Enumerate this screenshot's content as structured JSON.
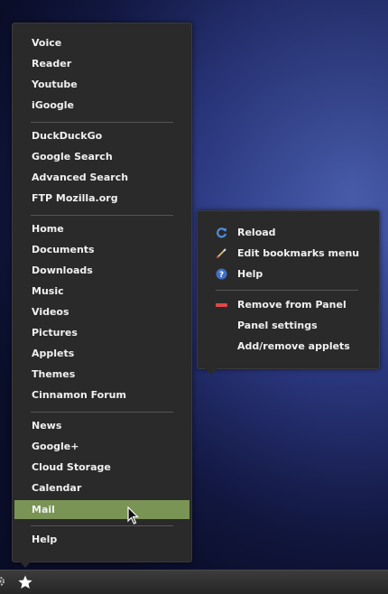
{
  "bookmarks_menu": {
    "groups": [
      [
        "Voice",
        "Reader",
        "Youtube",
        "iGoogle"
      ],
      [
        "DuckDuckGo",
        "Google Search",
        "Advanced Search",
        "FTP Mozilla.org"
      ],
      [
        "Home",
        "Documents",
        "Downloads",
        "Music",
        "Videos",
        "Pictures",
        "Applets",
        "Themes",
        "Cinnamon Forum"
      ],
      [
        "News",
        "Google+",
        "Cloud Storage",
        "Calendar",
        "Mail"
      ],
      [
        "Help"
      ]
    ],
    "active_item": "Mail",
    "active_color": "#7a9456"
  },
  "context_menu": {
    "items": [
      {
        "label": "Reload",
        "icon": "reload-icon"
      },
      {
        "label": "Edit bookmarks menu",
        "icon": "edit-icon"
      },
      {
        "label": "Help",
        "icon": "help-icon"
      },
      {
        "label": "Remove from Panel",
        "icon": "remove-icon"
      },
      {
        "label": "Panel settings",
        "icon": ""
      },
      {
        "label": "Add/remove applets",
        "icon": ""
      }
    ]
  },
  "panel": {
    "icons": [
      "settings-icon",
      "star-bookmarks-icon"
    ]
  }
}
